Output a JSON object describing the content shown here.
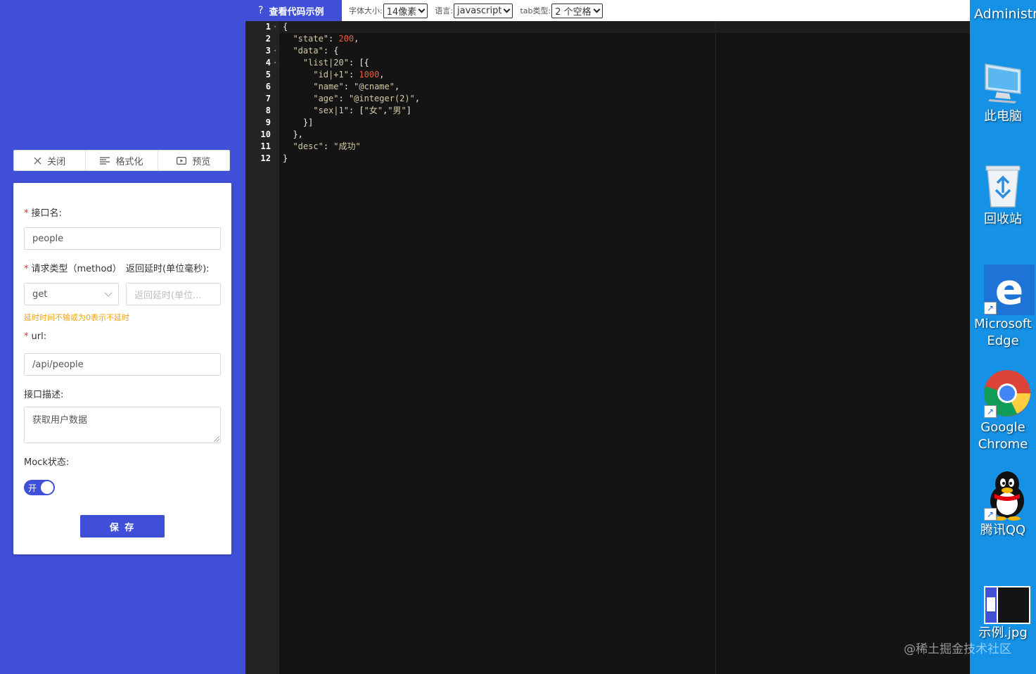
{
  "toolbar": {
    "close_label": "关闭",
    "format_label": "格式化",
    "preview_label": "预览"
  },
  "form": {
    "name_label": "接口名:",
    "name_value": "people",
    "method_label": "请求类型（method）",
    "delay_label": "返回延时(单位毫秒):",
    "method_value": "get",
    "delay_placeholder": "返回延时(单位...",
    "delay_hint": "延时时间不输或为0表示不延时",
    "url_label": "url:",
    "url_value": "/api/people",
    "desc_label": "接口描述:",
    "desc_value": "获取用户数据",
    "mock_label": "Mock状态:",
    "mock_switch_text": "开",
    "mock_enabled": true,
    "save_label": "保 存"
  },
  "topbar": {
    "example_label": "查看代码示例",
    "font_size_label": "字体大小:",
    "font_size_value": "14像素",
    "language_label": "语言:",
    "language_value": "javascript",
    "tab_type_label": "tab类型:",
    "tab_type_value": "2 个空格"
  },
  "editor": {
    "lines": [
      {
        "n": "1",
        "fold": true
      },
      {
        "n": "2",
        "fold": false
      },
      {
        "n": "3",
        "fold": true
      },
      {
        "n": "4",
        "fold": true
      },
      {
        "n": "5",
        "fold": false
      },
      {
        "n": "6",
        "fold": false
      },
      {
        "n": "7",
        "fold": false
      },
      {
        "n": "8",
        "fold": false
      },
      {
        "n": "9",
        "fold": false
      },
      {
        "n": "10",
        "fold": false
      },
      {
        "n": "11",
        "fold": false
      },
      {
        "n": "12",
        "fold": false
      }
    ],
    "code": [
      [
        {
          "t": "{",
          "c": "p"
        }
      ],
      [
        {
          "t": "  ",
          "c": "p"
        },
        {
          "t": "\"state\"",
          "c": "s"
        },
        {
          "t": ": ",
          "c": "p"
        },
        {
          "t": "200",
          "c": "n"
        },
        {
          "t": ",",
          "c": "p"
        }
      ],
      [
        {
          "t": "  ",
          "c": "p"
        },
        {
          "t": "\"data\"",
          "c": "s"
        },
        {
          "t": ": {",
          "c": "p"
        }
      ],
      [
        {
          "t": "    ",
          "c": "p"
        },
        {
          "t": "\"list|20\"",
          "c": "s"
        },
        {
          "t": ": [{",
          "c": "p"
        }
      ],
      [
        {
          "t": "      ",
          "c": "p"
        },
        {
          "t": "\"id|+1\"",
          "c": "s"
        },
        {
          "t": ": ",
          "c": "p"
        },
        {
          "t": "1000",
          "c": "n"
        },
        {
          "t": ",",
          "c": "p"
        }
      ],
      [
        {
          "t": "      ",
          "c": "p"
        },
        {
          "t": "\"name\"",
          "c": "s"
        },
        {
          "t": ": ",
          "c": "p"
        },
        {
          "t": "\"@cname\"",
          "c": "s"
        },
        {
          "t": ",",
          "c": "p"
        }
      ],
      [
        {
          "t": "      ",
          "c": "p"
        },
        {
          "t": "\"age\"",
          "c": "s"
        },
        {
          "t": ": ",
          "c": "p"
        },
        {
          "t": "\"@integer(2)\"",
          "c": "s"
        },
        {
          "t": ",",
          "c": "p"
        }
      ],
      [
        {
          "t": "      ",
          "c": "p"
        },
        {
          "t": "\"sex|1\"",
          "c": "s"
        },
        {
          "t": ": [",
          "c": "p"
        },
        {
          "t": "\"女\"",
          "c": "s"
        },
        {
          "t": ",",
          "c": "p"
        },
        {
          "t": "\"男\"",
          "c": "s"
        },
        {
          "t": "]",
          "c": "p"
        }
      ],
      [
        {
          "t": "    }]",
          "c": "p"
        }
      ],
      [
        {
          "t": "  },",
          "c": "p"
        }
      ],
      [
        {
          "t": "  ",
          "c": "p"
        },
        {
          "t": "\"desc\"",
          "c": "s"
        },
        {
          "t": ": ",
          "c": "p"
        },
        {
          "t": "\"成功\"",
          "c": "s"
        }
      ],
      [
        {
          "t": "}",
          "c": "p"
        }
      ]
    ]
  },
  "desktop": {
    "user_label": "Administr",
    "icons": [
      {
        "name": "this-pc",
        "label": "此电脑",
        "icon": "monitor-icon"
      },
      {
        "name": "recycle-bin",
        "label": "回收站",
        "icon": "recycle-bin-icon"
      },
      {
        "name": "edge",
        "label": "Microsoft Edge",
        "icon": "edge-icon"
      },
      {
        "name": "chrome",
        "label": "Google Chrome",
        "icon": "chrome-icon"
      },
      {
        "name": "qq",
        "label": "腾讯QQ",
        "icon": "qq-penguin-icon"
      },
      {
        "name": "example-jpg",
        "label": "示例.jpg",
        "icon": "image-file-icon"
      }
    ],
    "watermark": "@稀土掘金技术社区"
  },
  "colors": {
    "accent": "#3f4fd8",
    "editor_bg": "#141414",
    "string": "#d3c9a4",
    "number": "#e85d3e",
    "hint": "#f2a40c",
    "desktop_bg": "#1591e6"
  }
}
